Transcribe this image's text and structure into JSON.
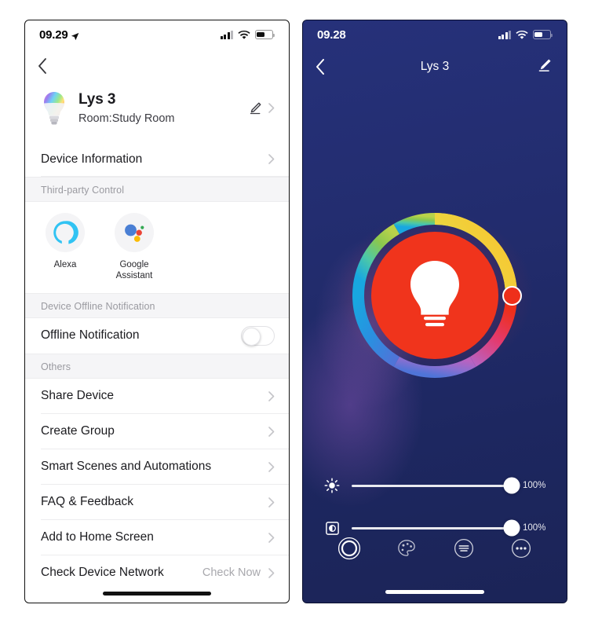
{
  "settings_screen": {
    "status_bar": {
      "time": "09.29",
      "location_icon": "location-arrow-icon",
      "signal_icon": "cellular-signal-icon",
      "wifi_icon": "wifi-icon",
      "battery_icon": "battery-icon"
    },
    "back_icon": "chevron-left-icon",
    "device": {
      "icon": "rgb-bulb-icon",
      "name": "Lys 3",
      "room": "Room:Study Room",
      "edit_icon": "pencil-edit-icon",
      "chevron_icon": "chevron-right-icon"
    },
    "device_information_label": "Device Information",
    "sections": {
      "third_party": {
        "header": "Third-party Control",
        "items": [
          {
            "label": "Alexa",
            "icon": "alexa-icon"
          },
          {
            "label": "Google\nAssistant",
            "icon": "google-assistant-icon"
          }
        ]
      },
      "offline": {
        "header": "Device Offline Notification",
        "row_label": "Offline Notification",
        "toggle_state": "off"
      },
      "others": {
        "header": "Others",
        "items": [
          {
            "label": "Share Device",
            "value": ""
          },
          {
            "label": "Create Group",
            "value": ""
          },
          {
            "label": "Smart Scenes and Automations",
            "value": ""
          },
          {
            "label": "FAQ & Feedback",
            "value": ""
          },
          {
            "label": "Add to Home Screen",
            "value": ""
          },
          {
            "label": "Check Device Network",
            "value": "Check Now"
          }
        ]
      }
    }
  },
  "control_screen": {
    "status_bar": {
      "time": "09.28",
      "signal_icon": "cellular-signal-icon",
      "wifi_icon": "wifi-icon",
      "battery_icon": "battery-icon"
    },
    "back_icon": "chevron-left-icon",
    "title": "Lys 3",
    "edit_icon": "pencil-edit-icon",
    "color_wheel": {
      "icon": "light-bulb-icon",
      "selected_color": "#ee2f1a",
      "inner_disc_color": "#f0341c",
      "handle_angle_deg": 0,
      "handle_label": "color-wheel-handle"
    },
    "sliders": [
      {
        "name": "brightness",
        "icon": "brightness-sun-icon",
        "value": "100%",
        "percent": 100
      },
      {
        "name": "color-temperature",
        "icon": "color-temperature-icon",
        "value": "100%",
        "percent": 100
      }
    ],
    "tabs": [
      {
        "name": "white-light",
        "icon": "white-circle-icon",
        "active": true
      },
      {
        "name": "color-light",
        "icon": "palette-icon",
        "active": false
      },
      {
        "name": "scenes",
        "icon": "scenes-list-icon",
        "active": false
      },
      {
        "name": "more",
        "icon": "more-dots-icon",
        "active": false
      }
    ]
  },
  "theme": {
    "accent_red": "#ee2f1a",
    "dark_bg": "#1f2a67",
    "section_bg": "#f5f5f7",
    "text_primary": "#1b1b1f",
    "text_muted": "#9a9aa0"
  }
}
